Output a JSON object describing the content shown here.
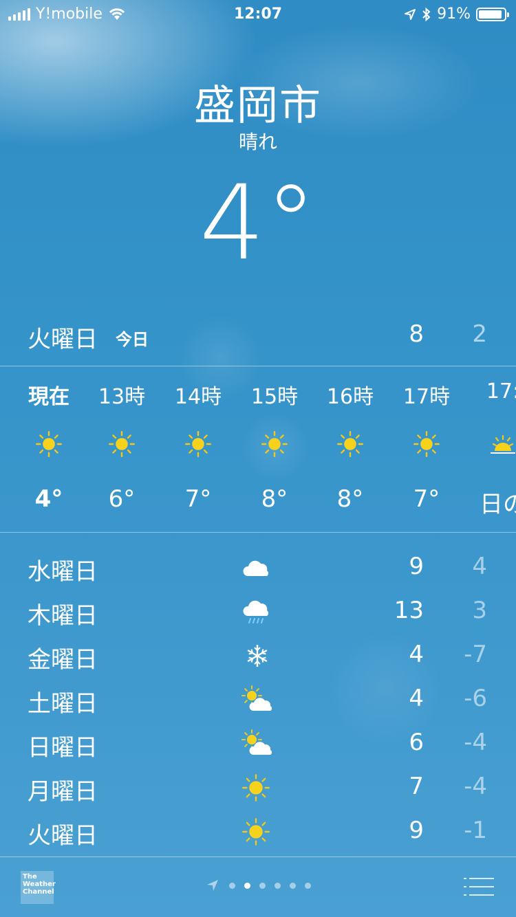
{
  "status_bar": {
    "carrier": "Y!mobile",
    "time": "12:07",
    "battery_percent": "91%",
    "battery_level": 0.91
  },
  "header": {
    "city": "盛岡市",
    "condition": "晴れ",
    "temperature": "4°"
  },
  "today": {
    "day": "火曜日",
    "label": "今日",
    "high": "8",
    "low": "2"
  },
  "hourly": [
    {
      "time": "現在",
      "icon": "sun-icon",
      "temp": "4°"
    },
    {
      "time": "13時",
      "icon": "sun-icon",
      "temp": "6°"
    },
    {
      "time": "14時",
      "icon": "sun-icon",
      "temp": "7°"
    },
    {
      "time": "15時",
      "icon": "sun-icon",
      "temp": "8°"
    },
    {
      "time": "16時",
      "icon": "sun-icon",
      "temp": "8°"
    },
    {
      "time": "17時",
      "icon": "sun-icon",
      "temp": "7°"
    },
    {
      "time": "17:",
      "icon": "sunset-icon",
      "temp": "日の"
    }
  ],
  "daily": [
    {
      "day": "水曜日",
      "icon": "cloud-icon",
      "high": "9",
      "low": "4"
    },
    {
      "day": "木曜日",
      "icon": "rain-cloud-icon",
      "high": "13",
      "low": "3"
    },
    {
      "day": "金曜日",
      "icon": "snowflake-icon",
      "high": "4",
      "low": "-7"
    },
    {
      "day": "土曜日",
      "icon": "partly-cloudy-icon",
      "high": "4",
      "low": "-6"
    },
    {
      "day": "日曜日",
      "icon": "partly-cloudy-icon",
      "high": "6",
      "low": "-4"
    },
    {
      "day": "月曜日",
      "icon": "sun-icon",
      "high": "7",
      "low": "-4"
    },
    {
      "day": "火曜日",
      "icon": "sun-icon",
      "high": "9",
      "low": "-1"
    }
  ],
  "footer": {
    "logo_text": "The Weather Channel",
    "page_count": 6,
    "active_page": 1
  },
  "colors": {
    "sun": "#f7d21c",
    "sun_ray": "#f2c81a"
  }
}
